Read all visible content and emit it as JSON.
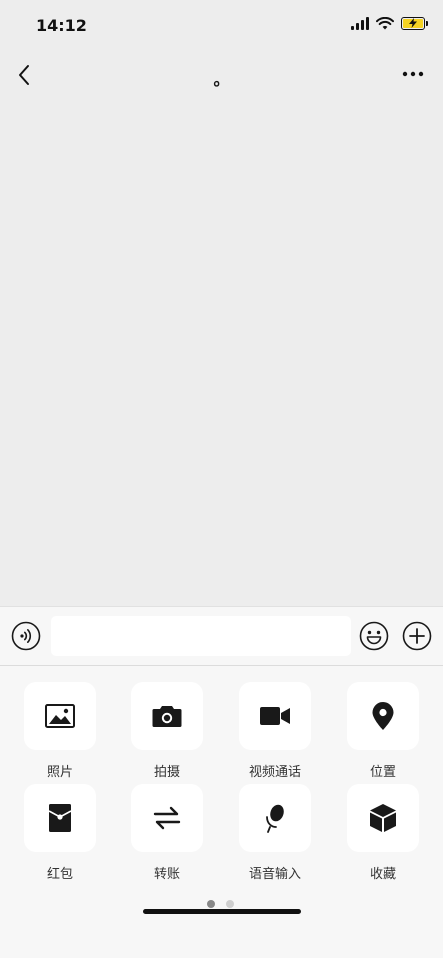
{
  "status_bar": {
    "time": "14:12",
    "signal_icon": "cellular-signal-icon",
    "wifi_icon": "wifi-icon",
    "battery_icon": "battery-charging-icon",
    "battery_color": "#F5D323"
  },
  "nav_bar": {
    "title": "。",
    "back_icon": "chevron-left-icon",
    "more_icon": "more-dots-icon"
  },
  "input_bar": {
    "voice_icon": "voice-icon",
    "message_value": "",
    "emoji_icon": "emoji-icon",
    "plus_icon": "plus-circle-icon"
  },
  "more_panel": {
    "items": [
      {
        "label": "照片",
        "icon": "photo-icon"
      },
      {
        "label": "拍摄",
        "icon": "camera-icon"
      },
      {
        "label": "视频通话",
        "icon": "video-call-icon"
      },
      {
        "label": "位置",
        "icon": "location-icon"
      },
      {
        "label": "红包",
        "icon": "red-packet-icon"
      },
      {
        "label": "转账",
        "icon": "transfer-icon"
      },
      {
        "label": "语音输入",
        "icon": "voice-input-icon"
      },
      {
        "label": "收藏",
        "icon": "favorites-icon"
      }
    ],
    "pages": 2,
    "current_page": 1,
    "dot_active_color": "#888888",
    "dot_inactive_color": "#CFCFCF"
  },
  "colors": {
    "background": "#EDEDED",
    "panel": "#F7F7F7",
    "icon": "#191919"
  }
}
